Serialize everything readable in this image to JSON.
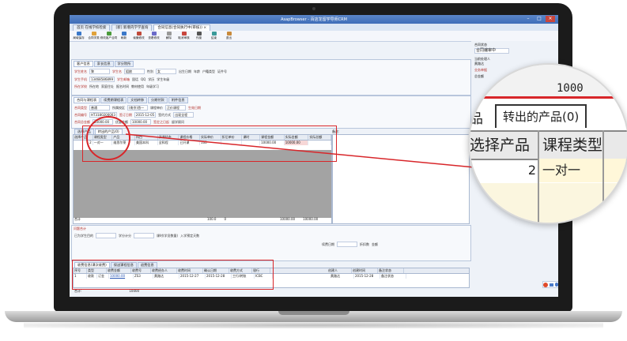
{
  "browser": {
    "title": "AsapBrowser - 百店龙留学导师CRM",
    "tabs": [
      {
        "label": "首页 在线学校检索",
        "active": false
      },
      {
        "label": "[新] 新增内学学查询",
        "active": false
      },
      {
        "label": "合同信息(合同执行中(审核)) ×",
        "active": true
      }
    ]
  },
  "toolbar": {
    "tools": [
      {
        "label": "局域保存",
        "icon": "save-icon",
        "color": "#3b78c9"
      },
      {
        "label": "合同学类",
        "icon": "list-icon",
        "color": "#e0a23b"
      },
      {
        "label": "修改客产合同",
        "icon": "edit-icon",
        "color": "#4a9a3b"
      },
      {
        "label": "刷新",
        "icon": "refresh-icon",
        "color": "#3b78c9"
      },
      {
        "label": "偷懒修改",
        "icon": "pen-icon",
        "color": "#c04a3b"
      },
      {
        "label": "查看修改",
        "icon": "view-icon",
        "color": "#6b6bc9"
      },
      {
        "label": "解除",
        "icon": "unlock-icon",
        "color": "#999999"
      },
      {
        "label": "取消审核",
        "icon": "cancel-icon",
        "color": "#c9463d"
      },
      {
        "label": "作废",
        "icon": "delete-icon",
        "color": "#555555"
      },
      {
        "label": "结束",
        "icon": "flag-icon",
        "color": "#3b9a9a"
      },
      {
        "label": "退出",
        "icon": "exit-icon",
        "color": "#c98a3b"
      }
    ]
  },
  "student_panel": {
    "tabs": [
      "客户信息",
      "家长信息",
      "学分院所"
    ],
    "rows": [
      [
        "学生姓名",
        "黎",
        "学生名",
        "姐娘",
        "性别",
        "女",
        "出生日期",
        "年龄",
        "户籍类型",
        "证件号"
      ],
      [
        "学生手机",
        "13468586899",
        "学生邮箱",
        "固话",
        "QQ",
        "学历",
        "学生年级"
      ],
      [
        "所在学校",
        "所在地",
        "家庭住址",
        "报名时间",
        "教材使用",
        "年级学习"
      ]
    ]
  },
  "contract_panel": {
    "tabs": [
      "合同与课程表",
      "续费期课程表",
      "文档转移",
      "分期付款",
      "附件信息"
    ],
    "contract_no": "HT3180200003",
    "amount": "10000.00",
    "fields": [
      [
        "合同类型",
        "普通",
        "所属校区",
        "(南京)首一",
        "课程单价",
        "正价课程",
        "生效日期"
      ],
      [
        "合同编号",
        "HT3180200003",
        "签订日期",
        "2015-12-05",
        "签约方式",
        "出现全程"
      ],
      [
        "合同总金额",
        "10000.00",
        "优惠金额",
        "10000.00",
        "签定之日起",
        "留学顾问"
      ]
    ]
  },
  "products_tabs": {
    "choose_label": "选择产品",
    "transfer_label": "转出的产品(0)",
    "right_label": "备注:"
  },
  "product_grid": {
    "headers": [
      "选择产品",
      "课程类型",
      "产品",
      "科目",
      "开课状态",
      "课程价格",
      "实际单价",
      "折后单价",
      "课时",
      "课程金额",
      "实际金额",
      "实际总额"
    ],
    "rows": [
      [
        "2",
        "一对一",
        "维思尔莱",
        "美国本科",
        "全科程",
        "已开课",
        "100",
        "",
        "",
        "10000.00",
        "10000.00",
        ""
      ]
    ],
    "total_label": "合计",
    "total_values": [
      "100.0",
      "0",
      "10000.00",
      "10000.00"
    ]
  },
  "summary": {
    "title": "问题合计",
    "rows": [
      [
        "已为学生目的",
        "学分计分",
        "课时(学员数量)",
        "入学预定天数"
      ],
      [
        "续费日期",
        "折扣数",
        "金额"
      ]
    ]
  },
  "payment_tabs": [
    "收费信息(课次收费)",
    "保送课程信息",
    "退费信息"
  ],
  "payment_grid": {
    "headers": [
      "序号",
      "类型",
      "收费金额",
      "收费号",
      "收费经办人",
      "收费时间",
      "确认日期",
      "收费方式",
      "银行"
    ],
    "rows": [
      [
        "1",
        "收款",
        "订金",
        "10000.00",
        "ZS3",
        "黄路达",
        "2015-12-27",
        "2015-12-28",
        "工行/转账",
        "ICBC"
      ]
    ],
    "right_headers": [
      "创建人",
      "创建时间",
      "备注状态"
    ],
    "right_row": [
      "黄路达",
      "2015-12-28",
      "备注状态"
    ]
  },
  "footer": {
    "total_label": "合计:",
    "total_value": "10000"
  },
  "right_sidebar": {
    "items": [
      "合同状态",
      "合同编审中",
      "当前处理人",
      "黄路达",
      "业务单据",
      "总金额"
    ]
  },
  "magnifier": {
    "amount_fragment": "1000",
    "partial_tab": "品",
    "transfer_tab": "转出的产品(0)",
    "header_choose": "选择产品",
    "header_type": "课程类型",
    "row_count": "2",
    "row_type": "一对一"
  },
  "colors": {
    "accent": "#3e6db8",
    "highlight": "#d8262a",
    "required_label": "#b4302a"
  }
}
